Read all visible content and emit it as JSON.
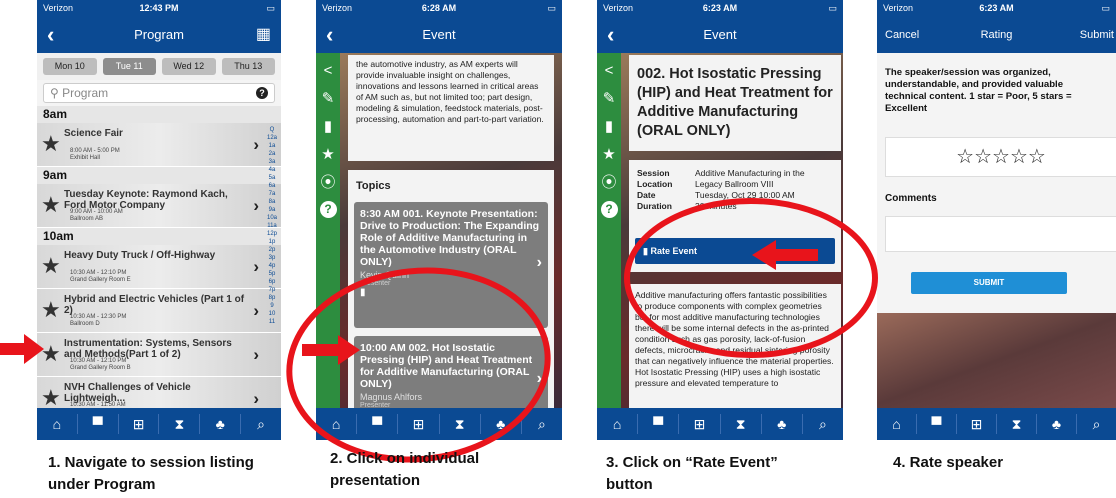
{
  "carrier": "Verizon",
  "phone1": {
    "time": "12:43 PM",
    "title": "Program",
    "days": [
      "Mon 10",
      "Tue 11",
      "Wed 12",
      "Thu 13"
    ],
    "search_placeholder": "Program",
    "sections": [
      {
        "hour": "8am",
        "items": [
          {
            "title": "Science Fair",
            "time": "8:00 AM - 5:00 PM",
            "room": "Exhibit Hall"
          }
        ]
      },
      {
        "hour": "9am",
        "items": [
          {
            "title": "Tuesday Keynote: Raymond Kach, Ford Motor Company",
            "time": "9:00 AM - 10:00 AM",
            "room": "Ballroom AB"
          }
        ]
      },
      {
        "hour": "10am",
        "items": [
          {
            "title": "Heavy Duty Truck / Off-Highway",
            "time": "10:30 AM - 12:10 PM",
            "room": "Grand Gallery Room E"
          },
          {
            "title": "Hybrid and Electric Vehicles (Part 1 of 2)",
            "time": "10:30 AM - 12:30 PM",
            "room": "Ballroom D"
          },
          {
            "title": "Instrumentation: Systems, Sensors and Methods(Part 1 of 2)",
            "time": "10:30 AM - 12:10 PM",
            "room": "Grand Gallery Room B"
          },
          {
            "title": "NVH Challenges of Vehicle Lightweigh...",
            "time": "10:30 AM - 11:50 AM",
            "room": "Grand Gallery Room D"
          }
        ]
      }
    ],
    "index": [
      "Q",
      "12a",
      "1a",
      "2a",
      "3a",
      "4a",
      "5a",
      "6a",
      "7a",
      "8a",
      "9a",
      "10a",
      "11a",
      "12p",
      "1p",
      "2p",
      "3p",
      "4p",
      "5p",
      "6p",
      "7p",
      "8p",
      "9",
      "10",
      "11"
    ]
  },
  "phone2": {
    "time": "6:28 AM",
    "title": "Event",
    "description": "the automotive industry, as AM experts will provide invaluable insight on challenges, innovations and lessons learned in critical areas of AM such as, but not limited too; part design, modeling & simulation, feedstock materials, post-processing, automation and part-to-part variation.",
    "topics_label": "Topics",
    "topic1": {
      "title": "8:30 AM  001. Keynote Presentation: Drive to Production: The Expanding Role of Additive Manufacturing in the Automotive Industry (ORAL ONLY)",
      "name": "Kevin Quinn",
      "role": "Presenter"
    },
    "topic2": {
      "title": "10:00 AM  002. Hot Isostatic Pressing (HIP) and Heat Treatment for Additive Manufacturing (ORAL ONLY)",
      "name": "Magnus Ahlfors",
      "role": "Presenter"
    }
  },
  "phone3": {
    "time": "6:23 AM",
    "title": "Event",
    "event_title": "002. Hot Isostatic Pressing (HIP) and Heat Treatment for Additive Manufacturing (ORAL ONLY)",
    "details": [
      {
        "label": "Session",
        "value": "Additive Manufacturing in the"
      },
      {
        "label": "Location",
        "value": "Legacy Ballroom VIII"
      },
      {
        "label": "Date",
        "value": "Tuesday, Oct 29 10:00 AM"
      },
      {
        "label": "Duration",
        "value": "30 minutes"
      }
    ],
    "rate_button": "Rate Event",
    "body": "Additive manufacturing offers fantastic possibilities to produce components with complex geometries but for most additive manufacturing technologies there will be some internal defects in the as-printed condition such as gas porosity, lack-of-fusion defects, microcracks and residual sintering porosity that can negatively influence the material properties. Hot Isostatic Pressing (HIP) uses a high isostatic pressure and elevated temperature to"
  },
  "phone4": {
    "time": "6:23 AM",
    "cancel": "Cancel",
    "title": "Rating",
    "submit_nav": "Submit",
    "prompt": "The speaker/session was organized, understandable, and provided valuable technical content. 1 star = Poor, 5 stars = Excellent",
    "stars": "☆☆☆☆☆",
    "comments_label": "Comments",
    "submit_button": "SUBMIT"
  },
  "tabbar": [
    "⌂",
    "▀",
    "⊞",
    "⧗",
    "♣",
    "⌕"
  ],
  "captions": [
    "1. Navigate to session listing under Program",
    "2. Click on individual presentation",
    "3. Click on “Rate Event” button",
    "4. Rate speaker"
  ],
  "colors": {
    "nav": "#0b4a93",
    "sidebar": "#2d8d3f",
    "annotation": "#e8141b",
    "button": "#1f8fd6"
  }
}
